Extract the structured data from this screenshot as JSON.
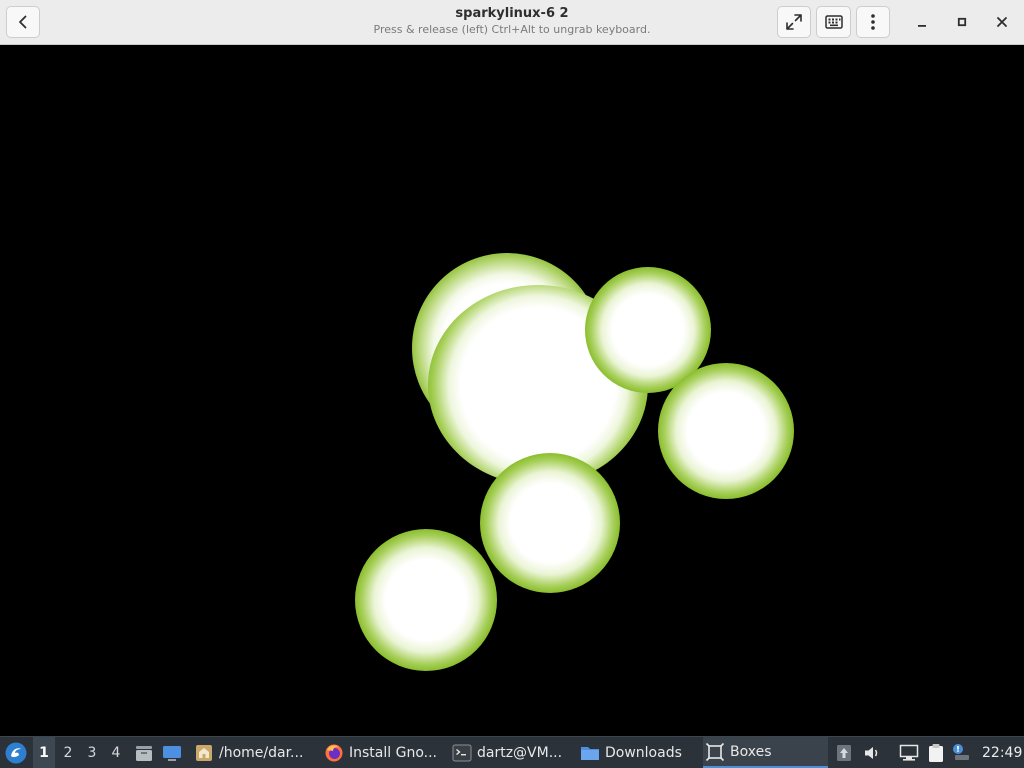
{
  "window": {
    "title": "sparkylinux-6 2",
    "subtitle": "Press & release (left) Ctrl+Alt to ungrab keyboard."
  },
  "headerbar": {
    "back_icon": "chevron-left-icon",
    "fullscreen_icon": "fullscreen-arrows-icon",
    "keyboard_icon": "keyboard-icon",
    "menu_icon": "vertical-ellipsis-icon",
    "minimize_icon": "minimize-icon",
    "maximize_icon": "maximize-icon",
    "close_icon": "close-icon"
  },
  "vm_screen": {
    "content": "lava-lamp-screensaver",
    "glow_color": "#7cb518",
    "core_color": "#ffffff"
  },
  "taskbar": {
    "workspaces": [
      "1",
      "2",
      "3",
      "4"
    ],
    "active_workspace": "1",
    "launchers": [
      {
        "icon": "file-manager-icon"
      },
      {
        "icon": "show-desktop-icon"
      }
    ],
    "tasks": [
      {
        "icon": "folder-home-icon",
        "label": "/home/dar..."
      },
      {
        "icon": "firefox-icon",
        "label": "Install Gno..."
      },
      {
        "icon": "terminal-icon",
        "label": "dartz@VM..."
      },
      {
        "icon": "folder-icon",
        "label": "Downloads"
      },
      {
        "icon": "boxes-icon",
        "label": "Boxes",
        "active": true
      }
    ],
    "tray": [
      {
        "icon": "updates-icon"
      },
      {
        "icon": "volume-icon"
      },
      {
        "icon": "network-icon"
      },
      {
        "icon": "clipboard-icon"
      },
      {
        "icon": "notification-icon"
      }
    ],
    "clock": "22:49",
    "accent": "#4a90d9"
  }
}
